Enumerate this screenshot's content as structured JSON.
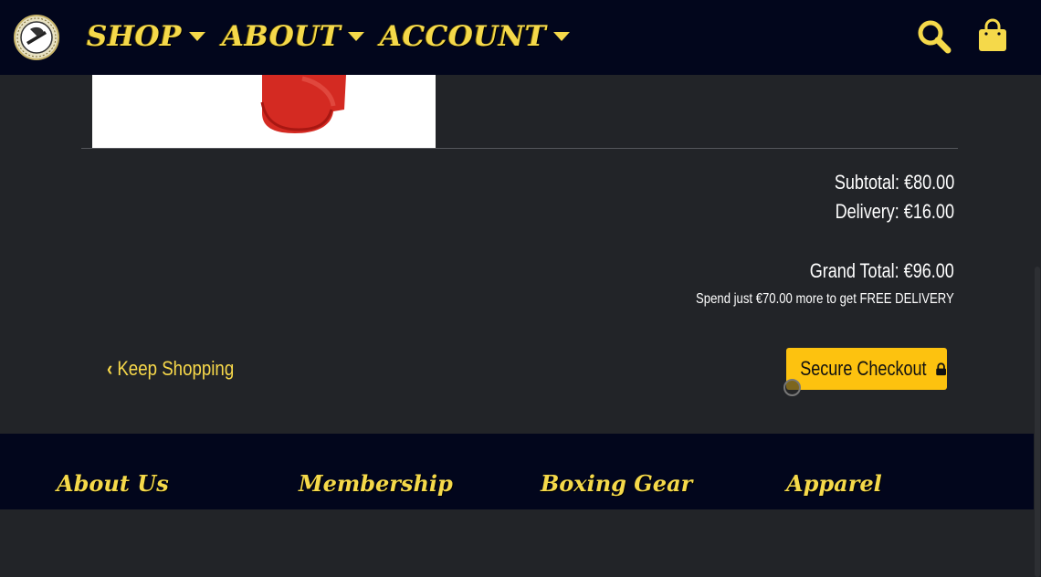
{
  "nav": {
    "items": [
      {
        "label": "SHOP"
      },
      {
        "label": "ABOUT"
      },
      {
        "label": "ACCOUNT"
      }
    ],
    "search_icon": "search-icon",
    "bag_icon": "shopping-bag-icon"
  },
  "summary": {
    "subtotal": "Subtotal: €80.00",
    "delivery": "Delivery: €16.00",
    "grand_total": "Grand Total: €96.00",
    "free_delivery_msg": "Spend just €70.00 more to get FREE DELIVERY"
  },
  "actions": {
    "keep_shopping": "Keep Shopping",
    "checkout": "Secure Checkout"
  },
  "footer": {
    "headings": [
      "About Us",
      "Membership",
      "Boxing Gear",
      "Apparel"
    ]
  },
  "colors": {
    "accent": "#fdc20f",
    "nav_bg": "#02061c",
    "page_bg": "#222428"
  }
}
